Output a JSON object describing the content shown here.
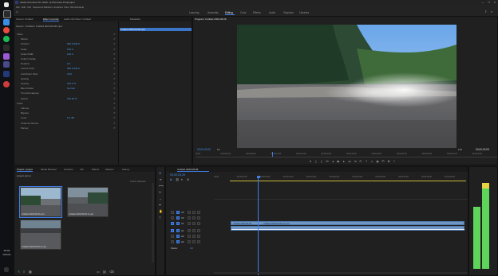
{
  "titlebar": {
    "title": "Adobe Premiere Pro 2020 - E:\\Premiere Pro\\project"
  },
  "menu": [
    "File",
    "Edit",
    "Clip",
    "Sequence",
    "Markers",
    "Graphics",
    "View",
    "Window",
    "Help"
  ],
  "workspaces": [
    "Learning",
    "Assembly",
    "Editing",
    "Color",
    "Effects",
    "Audio",
    "Graphics",
    "Libraries"
  ],
  "active_workspace": "Editing",
  "source_panel": {
    "tabs": [
      "Source: Untitled",
      "Effect Controls",
      "Audio Clip Mixer: Untitled",
      "Metadata"
    ],
    "header_clip": "Source - Untitled / Untitled 2020-09-06.mp4",
    "clip_bar_label": "Untitled 2020-09-06.mp4",
    "rows": [
      {
        "label": "Video"
      },
      {
        "label": "Motion"
      },
      {
        "label": "Position",
        "value": "960.0   540.0"
      },
      {
        "label": "Scale",
        "value": "100.0"
      },
      {
        "label": "Scale Width",
        "value": "100.0"
      },
      {
        "label": "Uniform Scale"
      },
      {
        "label": "Rotation",
        "value": "0.0"
      },
      {
        "label": "Anchor Point",
        "value": "960.0   540.0"
      },
      {
        "label": "Anti-flicker Filter",
        "value": "0.00"
      },
      {
        "label": "Opacity"
      },
      {
        "label": "Opacity",
        "value": "100.0 %"
      },
      {
        "label": "Blend Mode",
        "value": "Normal"
      },
      {
        "label": "Time Remapping"
      },
      {
        "label": "Speed",
        "value": "100.00 %"
      },
      {
        "label": "Audio"
      },
      {
        "label": "Volume"
      },
      {
        "label": "Bypass"
      },
      {
        "label": "Level",
        "value": "0.0 dB"
      },
      {
        "label": "Channel Volume"
      },
      {
        "label": "Panner"
      }
    ]
  },
  "program_monitor": {
    "title": "Program: Untitled 2020-09-06",
    "timecode_left": "00;00;03;26",
    "timecode_right": "00;00;22;09",
    "ruler": [
      "00;00",
      "00;00;04;00",
      "00;00;08;00",
      "00;00;12;00",
      "00;00;16;00",
      "00;00;20;00",
      "00;00;24;00",
      "00;00;28;00",
      "00;00;32;00",
      "00;00;36;00",
      "00;00;40;00",
      "00;00;44;00"
    ],
    "fit_label": "Fit",
    "quality_label": "Full",
    "transport": [
      "marker",
      "in",
      "out",
      "go-to-in",
      "step-back",
      "play",
      "step-forward",
      "go-to-out",
      "insert",
      "overwrite",
      "lift",
      "extract",
      "export-frame",
      "compare",
      "settings",
      "add"
    ]
  },
  "project_panel": {
    "tabs": [
      "Project: project",
      "Media Browser",
      "Libraries",
      "Info",
      "Effects",
      "Markers",
      "History"
    ],
    "project_file": "project.prproj",
    "items_count": "3 Items Selected",
    "clips": [
      {
        "name": "Untitled 2020-09-06.mp4",
        "duration": "0:22"
      },
      {
        "name": "Untitled 2020-09-06 1.mp4",
        "duration": "0:18"
      },
      {
        "name": "Untitled 2020-09-06 2.mp4",
        "duration": "0:10"
      }
    ]
  },
  "timeline": {
    "tab": "Untitled 2020-09-06",
    "timecode": "00;00;03;26",
    "ruler": [
      "00;00",
      "00;00;04;00",
      "00;00;08;00",
      "00;00;12;00",
      "00;00;16;00",
      "00;00;20;00",
      "00;00;24;00",
      "00;00;28;00",
      "00;00;32;00",
      "00;00;36;00",
      "00;00;40;00"
    ],
    "video_tracks": [
      "V3",
      "V2",
      "V1"
    ],
    "audio_tracks": [
      "A1",
      "A2",
      "A3"
    ],
    "master": "Master",
    "master_value": "0.0",
    "clip_v1": [
      {
        "name": "Untitled 2020-09-06"
      },
      {
        "name": "Untitled 2020-09-06.mp4 [V]"
      }
    ],
    "clip_a1": []
  },
  "tools": [
    "selection",
    "track-select",
    "ripple",
    "razor",
    "slip",
    "pen",
    "hand",
    "type"
  ],
  "clock": {
    "time": "01:44",
    "date": "9/6/2020"
  },
  "colors": {
    "accent": "#3f7ee8",
    "clip": "#6a8fb8",
    "audio_meter": "#5fd45a",
    "audio_meter_top": "#e5d344"
  }
}
